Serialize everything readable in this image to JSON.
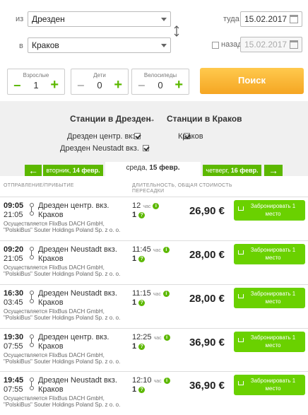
{
  "search": {
    "from_label": "из",
    "from_value": "Дрезден",
    "to_label": "в",
    "to_value": "Краков",
    "depart_label": "туда",
    "depart_value": "15.02.2017",
    "return_label": "назад",
    "return_value": "15.02.2017",
    "adults_label": "Взрослые",
    "adults_value": "1",
    "children_label": "Дети",
    "children_value": "0",
    "bikes_label": "Велосипеды",
    "bikes_value": "0",
    "minus_symbol": "−",
    "plus_symbol": "+",
    "search_button": "Поиск"
  },
  "stations": {
    "from_heading": "Станции в Дрезден",
    "arrow": "→",
    "to_heading": "Станции в Краков",
    "from_items": [
      "Дрезден центр. вкз.",
      "Дрезден Neustadt вкз."
    ],
    "to_items": [
      "Краков"
    ]
  },
  "days": {
    "prev_arrow": "←",
    "prev_day": "вторник, ",
    "prev_date": "14 февр.",
    "current_day": "среда, ",
    "current_date": "15 февр.",
    "next_day": "четверг, ",
    "next_date": "16 февр.",
    "next_arrow": "→"
  },
  "columns": {
    "departure_arrival": "ОТПРАВЛЕНИЕ/ПРИБЫТИЕ",
    "duration_line1": "ДЛИТЕЛЬНОСТЬ, ОБЩАЯ СТОИМОСТЬ",
    "duration_line2": "ПЕРЕСАДКИ"
  },
  "trips": [
    {
      "dep": "09:05",
      "arr": "21:05",
      "from": "Дрезден центр. вкз.",
      "to": "Краков",
      "op1": "Осуществляется FlixBus DACH GmbH,",
      "op2": "\"PolskiBus\" Souter Holdings Poland Sp. z o. o.",
      "duration": "12",
      "dur_unit": "час",
      "transfers": "1",
      "price": "26,90 €",
      "book_line1": "Забронировать 1",
      "book_line2": "место"
    },
    {
      "dep": "09:20",
      "arr": "21:05",
      "from": "Дрезден Neustadt вкз.",
      "to": "Краков",
      "op1": "Осуществляется FlixBus DACH GmbH,",
      "op2": "\"PolskiBus\" Souter Holdings Poland Sp. z o. o.",
      "duration": "11:45",
      "dur_unit": "час",
      "transfers": "1",
      "price": "28,00 €",
      "book_line1": "Забронировать 1",
      "book_line2": "место"
    },
    {
      "dep": "16:30",
      "arr": "03:45",
      "from": "Дрезден Neustadt вкз.",
      "to": "Краков",
      "op1": "Осуществляется FlixBus DACH GmbH,",
      "op2": "\"PolskiBus\" Souter Holdings Poland Sp. z o. o.",
      "duration": "11:15",
      "dur_unit": "час",
      "transfers": "1",
      "price": "28,00 €",
      "book_line1": "Забронировать 1",
      "book_line2": "место"
    },
    {
      "dep": "19:30",
      "arr": "07:55",
      "from": "Дрезден центр. вкз.",
      "to": "Краков",
      "op1": "Осуществляется FlixBus DACH GmbH,",
      "op2": "\"PolskiBus\" Souter Holdings Poland Sp. z o. o.",
      "duration": "12:25",
      "dur_unit": "час",
      "transfers": "1",
      "price": "36,90 €",
      "book_line1": "Забронировать 1",
      "book_line2": "место"
    },
    {
      "dep": "19:45",
      "arr": "07:55",
      "from": "Дрезден Neustadt вкз.",
      "to": "Краков",
      "op1": "Осуществляется FlixBus DACH GmbH,",
      "op2": "\"PolskiBus\" Souter Holdings Poland Sp. z o. o.",
      "duration": "12:10",
      "dur_unit": "час",
      "transfers": "1",
      "price": "36,90 €",
      "book_line1": "Забронировать 1",
      "book_line2": "место"
    }
  ],
  "icons": {
    "info": "i",
    "transfer_help": "?"
  },
  "colors": {
    "accent_green": "#5cb800",
    "book_green": "#6ad100",
    "search_orange": "#f5a623"
  }
}
